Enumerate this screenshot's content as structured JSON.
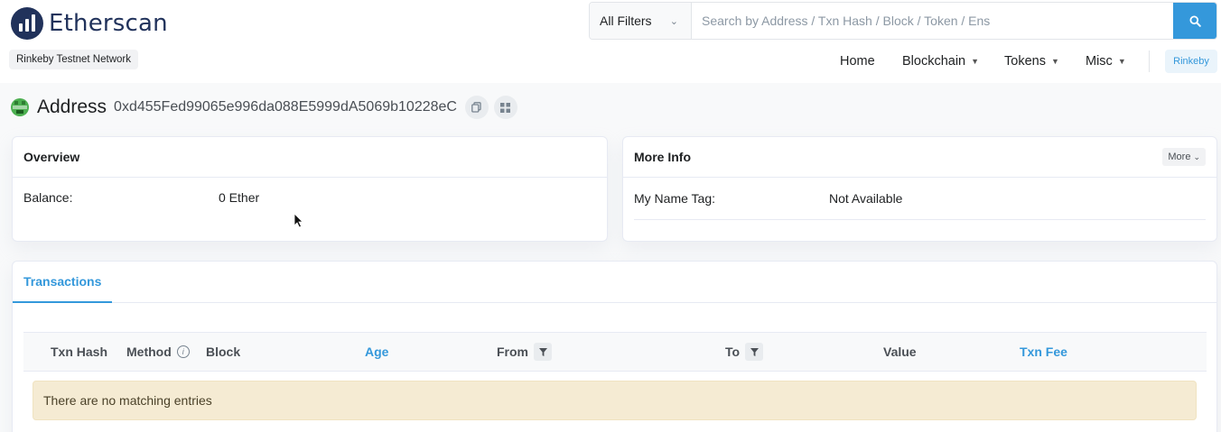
{
  "header": {
    "brand": "Etherscan",
    "network_badge": "Rinkeby Testnet Network",
    "search": {
      "filter_selected": "All Filters",
      "placeholder": "Search by Address / Txn Hash / Block / Token / Ens"
    },
    "nav": {
      "home": "Home",
      "blockchain": "Blockchain",
      "tokens": "Tokens",
      "misc": "Misc"
    },
    "network_button": "Rinkeby"
  },
  "address": {
    "label": "Address",
    "value": "0xd455Fed99065e996da088E5999dA5069b10228eC"
  },
  "overview": {
    "title": "Overview",
    "balance_label": "Balance:",
    "balance_value": "0 Ether"
  },
  "more_info": {
    "title": "More Info",
    "more_button": "More",
    "name_tag_label": "My Name Tag:",
    "name_tag_value": "Not Available"
  },
  "transactions": {
    "tab_label": "Transactions",
    "columns": {
      "txn_hash": "Txn Hash",
      "method": "Method",
      "block": "Block",
      "age": "Age",
      "from": "From",
      "to": "To",
      "value": "Value",
      "txn_fee": "Txn Fee"
    },
    "empty_message": "There are no matching entries"
  },
  "colors": {
    "brand": "#21325b",
    "accent": "#3498db",
    "empty_bg": "#f5ebd3"
  }
}
